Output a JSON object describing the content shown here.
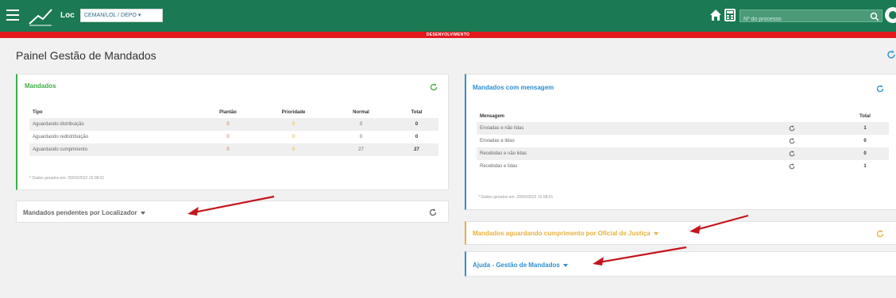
{
  "topbar": {
    "loc_label": "Loc",
    "loc_value": "CEMAN/LOL / DEPO ▾",
    "search_placeholder": "Nº do processo",
    "env_label": "DESENVOLVIMENTO",
    "brand_color": "#1b7a53",
    "env_color": "#e3191e"
  },
  "page": {
    "title": "Painel Gestão de Mandados"
  },
  "mandados": {
    "title": "Mandados",
    "headers": [
      "Tipo",
      "Plantão",
      "Prioridade",
      "Normal",
      "Total"
    ],
    "rows": [
      {
        "tipo": "Aguardando distribuição",
        "plantao": "0",
        "prioridade": "0",
        "normal": "0",
        "total": "0"
      },
      {
        "tipo": "Aguardando redistribuição",
        "plantao": "0",
        "prioridade": "0",
        "normal": "0",
        "total": "0"
      },
      {
        "tipo": "Aguardando cumprimento",
        "plantao": "0",
        "prioridade": "0",
        "normal": "27",
        "total": "27"
      }
    ],
    "footnote": "* Dados gerados em: 20/09/2022 15:08:01"
  },
  "pendentes": {
    "title": "Mandados pendentes por Localizador"
  },
  "mensagens": {
    "title": "Mandados com mensagem",
    "headers": [
      "Mensagem",
      "Total"
    ],
    "rows": [
      {
        "mensagem": "Enviadas e não lidas",
        "total": "1"
      },
      {
        "mensagem": "Enviadas e lidas",
        "total": "0"
      },
      {
        "mensagem": "Recebidas e não lidas",
        "total": "0"
      },
      {
        "mensagem": "Recebidas e lidas",
        "total": "1"
      }
    ],
    "footnote": "* Dados gerados em: 20/09/2022 15:08:01"
  },
  "oficial": {
    "title": "Mandados aguardando cumprimento por Oficial de Justiça",
    "color": "#e6b13d"
  },
  "ajuda": {
    "title": "Ajuda - Gestão de Mandados",
    "color": "#2f8fcf"
  },
  "colors": {
    "green_accent": "#3fae49",
    "blue_accent": "#2f8fcf",
    "orange_accent": "#e6b13d",
    "arrow": "#c4161c"
  }
}
